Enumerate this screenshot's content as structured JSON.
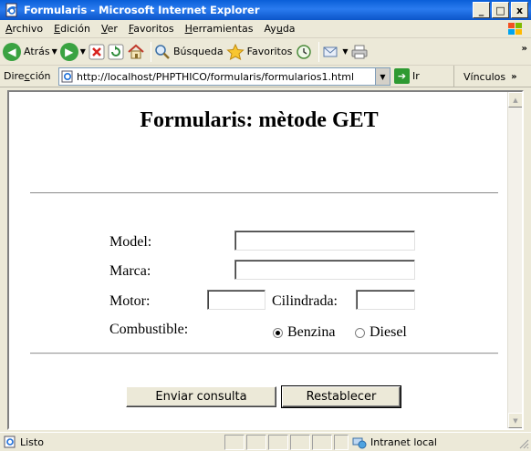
{
  "window": {
    "title": "Formularis - Microsoft Internet Explorer",
    "minimize": "_",
    "maximize": "□",
    "close": "x"
  },
  "menu": {
    "items": [
      {
        "pre": "",
        "acc": "A",
        "post": "rchivo"
      },
      {
        "pre": "",
        "acc": "E",
        "post": "dición"
      },
      {
        "pre": "",
        "acc": "V",
        "post": "er"
      },
      {
        "pre": "",
        "acc": "F",
        "post": "avoritos"
      },
      {
        "pre": "",
        "acc": "H",
        "post": "erramientas"
      },
      {
        "pre": "Ay",
        "acc": "u",
        "post": "da"
      }
    ]
  },
  "toolbar": {
    "back_label": "Atrás",
    "search_label": "Búsqueda",
    "favorites_label": "Favoritos",
    "more": "»"
  },
  "address": {
    "label_pre": "Dire",
    "label_acc": "c",
    "label_post": "ción",
    "url": "http://localhost/PHPTHICO/formularis/formularios1.html",
    "go_label": "Ir",
    "links_label": "Vínculos",
    "links_more": "»"
  },
  "page": {
    "heading": "Formularis: mètode GET",
    "labels": {
      "model": "Model:",
      "marca": "Marca:",
      "motor": "Motor:",
      "cilindrada": "Cilindrada:",
      "combustible": "Combustible:"
    },
    "values": {
      "model": "",
      "marca": "",
      "motor": "",
      "cilindrada": ""
    },
    "radio": {
      "option1": "Benzina",
      "option2": "Diesel",
      "selected": "Benzina"
    },
    "buttons": {
      "submit": "Enviar consulta",
      "reset": "Restablecer"
    }
  },
  "status": {
    "text": "Listo",
    "zone": "Intranet local"
  },
  "colors": {
    "title_bar": "#0A5FD8",
    "chrome": "#ECE9D8"
  }
}
